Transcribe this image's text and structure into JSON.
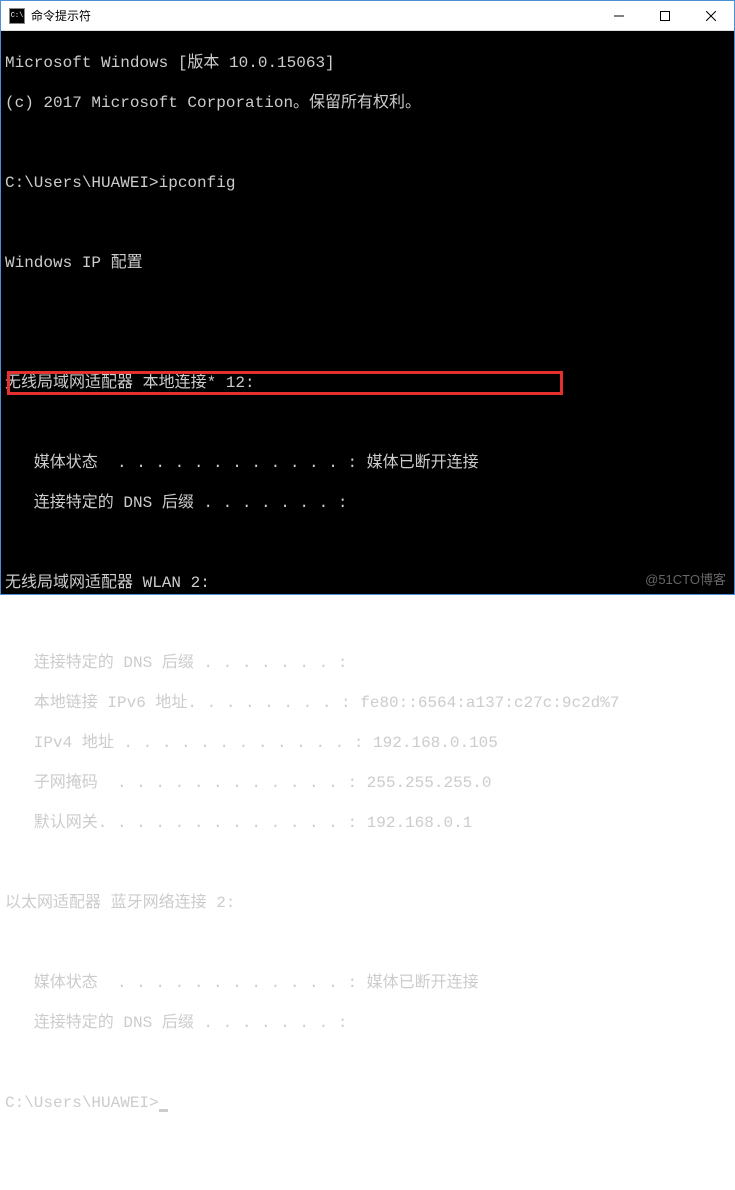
{
  "window": {
    "title": "命令提示符",
    "icon_label": "C:\\"
  },
  "header": {
    "version_line": "Microsoft Windows [版本 10.0.15063]",
    "copyright_line": "(c) 2017 Microsoft Corporation。保留所有权利。"
  },
  "prompt1": {
    "path": "C:\\Users\\HUAWEI>",
    "command": "ipconfig"
  },
  "ipconfig_title": "Windows IP 配置",
  "adapter1": {
    "header": "无线局域网适配器 本地连接* 12:",
    "media_state": "   媒体状态  . . . . . . . . . . . . : 媒体已断开连接",
    "dns_suffix": "   连接特定的 DNS 后缀 . . . . . . . :"
  },
  "adapter2": {
    "header": "无线局域网适配器 WLAN 2:",
    "dns_suffix": "   连接特定的 DNS 后缀 . . . . . . . :",
    "ipv6": "   本地链接 IPv6 地址. . . . . . . . : fe80::6564:a137:c27c:9c2d%7",
    "ipv4": "   IPv4 地址 . . . . . . . . . . . . : 192.168.0.105",
    "subnet": "   子网掩码  . . . . . . . . . . . . : 255.255.255.0",
    "gateway": "   默认网关. . . . . . . . . . . . . : 192.168.0.1"
  },
  "adapter3": {
    "header": "以太网适配器 蓝牙网络连接 2:",
    "media_state": "   媒体状态  . . . . . . . . . . . . : 媒体已断开连接",
    "dns_suffix": "   连接特定的 DNS 后缀 . . . . . . . :"
  },
  "prompt2": {
    "path": "C:\\Users\\HUAWEI>"
  },
  "watermark": "@51CTO博客"
}
